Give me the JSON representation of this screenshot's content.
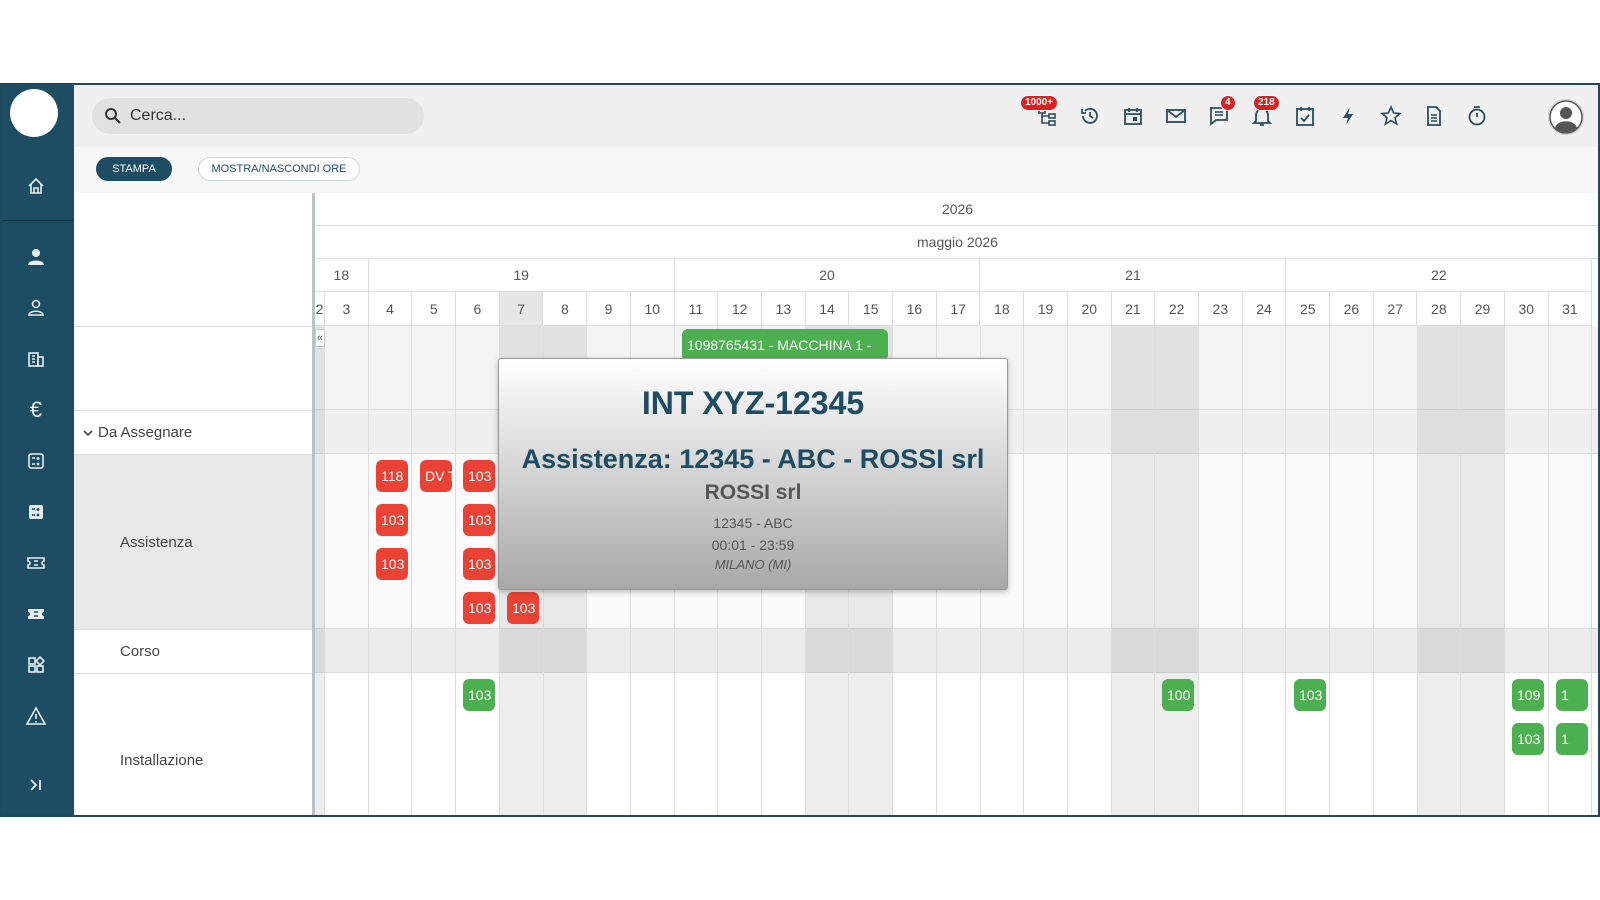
{
  "search": {
    "placeholder": "Cerca..."
  },
  "header": {
    "badges": {
      "network": "1000+",
      "messages": "4",
      "notifications": "218"
    }
  },
  "toolbar": {
    "stampa": "STAMPA",
    "mostra": "MOSTRA/NASCONDI ORE"
  },
  "calendar": {
    "year": "2026",
    "month": "maggio 2026",
    "weeks": [
      "18",
      "19",
      "20",
      "21",
      "22"
    ],
    "days": [
      "2",
      "3",
      "4",
      "5",
      "6",
      "7",
      "8",
      "9",
      "10",
      "11",
      "12",
      "13",
      "14",
      "15",
      "16",
      "17",
      "18",
      "19",
      "20",
      "21",
      "22",
      "23",
      "24",
      "25",
      "26",
      "27",
      "28",
      "29",
      "30",
      "31"
    ],
    "collapse": "«"
  },
  "rows": {
    "group": "Da Assegnare",
    "assistenza": "Assistenza",
    "corso": "Corso",
    "installazione": "Installazione"
  },
  "events": {
    "top_bar": "1098765431 - MACCHINA 1 -",
    "a1": "118",
    "a2": "DV T",
    "a3": "103",
    "a4": "103",
    "a5": "103",
    "a6": "103",
    "a7": "103",
    "a8": "103",
    "a9": "103",
    "i1": "103",
    "i2": "100",
    "i3": "103",
    "i4": "109",
    "i5": "1",
    "i6": "103",
    "i7": "1"
  },
  "tooltip": {
    "title": "INT XYZ-12345",
    "subtitle": "Assistenza: 12345 - ABC - ROSSI srl",
    "company": "ROSSI srl",
    "code": "12345 - ABC",
    "time": "00:01 - 23:59",
    "location": "MILANO (MI)"
  },
  "colors": {
    "sidebar": "#1c4d62",
    "event_red": "#ea4335",
    "event_green": "#4caf50"
  }
}
